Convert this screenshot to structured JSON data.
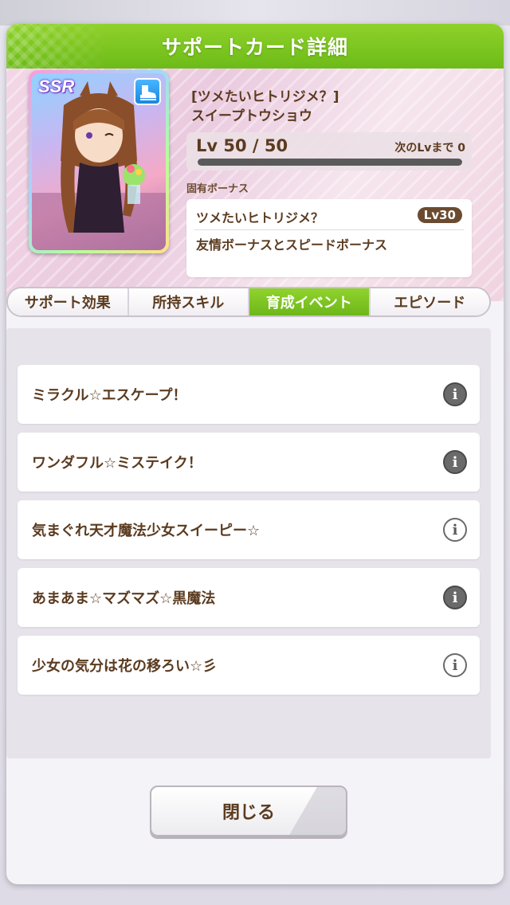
{
  "modal": {
    "title": "サポートカード詳細"
  },
  "card": {
    "rarity": "SSR",
    "type_icon": "speed-boot-icon",
    "name_line1": "[ツメたいヒトリジメ？]",
    "name_line2": "スイープトウショウ",
    "level_text": "Lv 50 / 50",
    "next_level_text": "次のLvまで 0",
    "level_progress": 1.0
  },
  "unique_bonus": {
    "label": "固有ボーナス",
    "title": "ツメたいヒトリジメ？",
    "level_badge": "Lv30",
    "description": "友情ボーナスとスピードボーナス"
  },
  "tabs": [
    {
      "label": "サポート効果",
      "active": false
    },
    {
      "label": "所持スキル",
      "active": false
    },
    {
      "label": "育成イベント",
      "active": true
    },
    {
      "label": "エピソード",
      "active": false
    }
  ],
  "events": [
    {
      "label": "ミラクル☆エスケープ！",
      "info_style": "filled"
    },
    {
      "label": "ワンダフル☆ミステイク！",
      "info_style": "filled"
    },
    {
      "label": "気まぐれ天才魔法少女スイーピー☆",
      "info_style": "outline"
    },
    {
      "label": "あまあま☆マズマズ☆黒魔法",
      "info_style": "filled"
    },
    {
      "label": "少女の気分は花の移ろい☆彡",
      "info_style": "outline"
    }
  ],
  "info_icon_glyph": "i",
  "close_button": {
    "label": "閉じる"
  },
  "colors": {
    "accent_green": "#7cc522",
    "text_brown": "#5b3b1f"
  }
}
